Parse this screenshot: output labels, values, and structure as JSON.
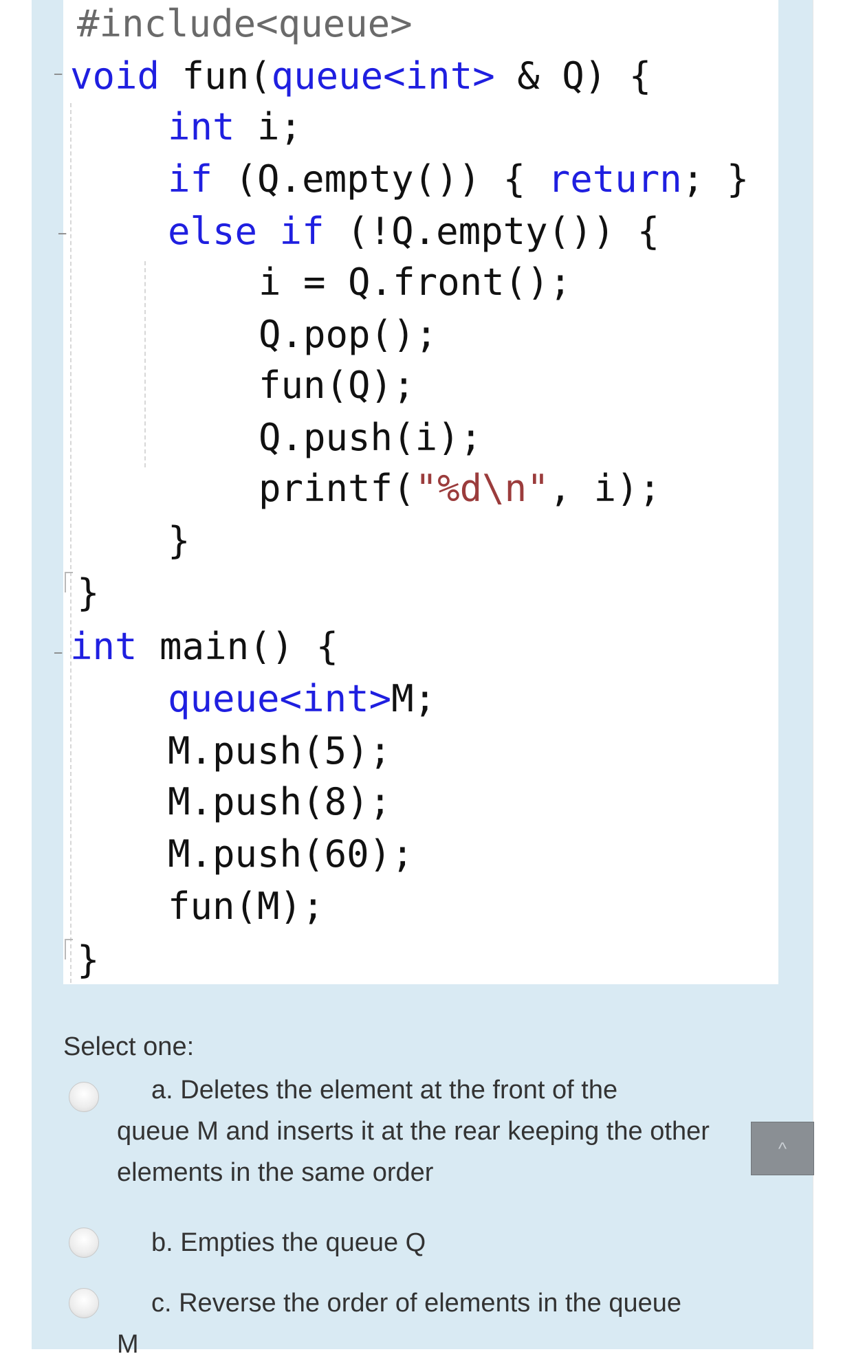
{
  "code": {
    "include": "#include<queue>",
    "fun_keyword": "void",
    "fun_signature_a": " fun(",
    "fun_param_type": "queue<int>",
    "fun_signature_b": " & Q) {",
    "decl_type": "int",
    "decl_rest": " i;",
    "if_kw": "if",
    "if_cond": " (Q.empty()) { ",
    "return_kw": "return",
    "if_end": "; }",
    "else_kw": "else if",
    "else_cond": " (!Q.empty()) {",
    "line_front": "i = Q.front();",
    "line_pop": "Q.pop();",
    "line_recurse": "fun(Q);",
    "line_push": "Q.push(i);",
    "printf_a": "printf(",
    "printf_str": "\"%d\\n\"",
    "printf_b": ", i);",
    "close_else": "}",
    "close_fun": "}",
    "main_kw": "int",
    "main_rest": " main() {",
    "main_decl": "queue<int>",
    "main_decl_rest": "M;",
    "main_push1": "M.push(5);",
    "main_push2": "M.push(8);",
    "main_push3": "M.push(60);",
    "main_call": "fun(M);",
    "close_main": "}"
  },
  "quiz": {
    "prompt": "Select one:",
    "options": [
      {
        "line1": "a. Deletes the element at the front of the",
        "rest": "queue M and inserts it at the rear keeping the other elements in the same order"
      },
      {
        "line1": "b. Empties the queue Q",
        "rest": ""
      },
      {
        "line1": "c. Reverse the order of elements in the queue",
        "rest": "M"
      }
    ]
  },
  "scroll_button": {
    "icon": "chevron-up-icon",
    "glyph": "^"
  },
  "colors": {
    "panel": "#d9eaf3",
    "keyword": "#1f1fe0",
    "button": "#8a8f94"
  }
}
